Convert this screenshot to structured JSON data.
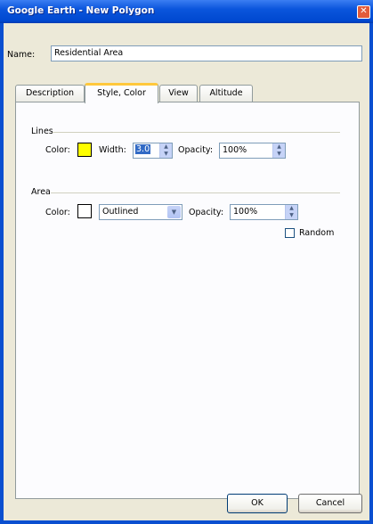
{
  "window": {
    "title": "Google Earth - New Polygon",
    "close_glyph": "✕"
  },
  "name_field": {
    "label": "Name:",
    "value": "Residential Area"
  },
  "tabs": [
    {
      "label": "Description",
      "active": false
    },
    {
      "label": "Style, Color",
      "active": true
    },
    {
      "label": "View",
      "active": false
    },
    {
      "label": "Altitude",
      "active": false
    }
  ],
  "lines": {
    "group_label": "Lines",
    "color_label": "Color:",
    "color_value": "#ffff00",
    "width_label": "Width:",
    "width_value": "3.0",
    "opacity_label": "Opacity:",
    "opacity_value": "100%"
  },
  "area": {
    "group_label": "Area",
    "color_label": "Color:",
    "color_value": "#ffffff",
    "fill_mode": "Outlined",
    "opacity_label": "Opacity:",
    "opacity_value": "100%",
    "random_label": "Random",
    "random_checked": false
  },
  "buttons": {
    "ok": "OK",
    "cancel": "Cancel"
  },
  "colors": {
    "titlebar": "#0a55dc",
    "dialog_bg": "#ece9d8",
    "active_tab_accent": "#ffc83c"
  }
}
